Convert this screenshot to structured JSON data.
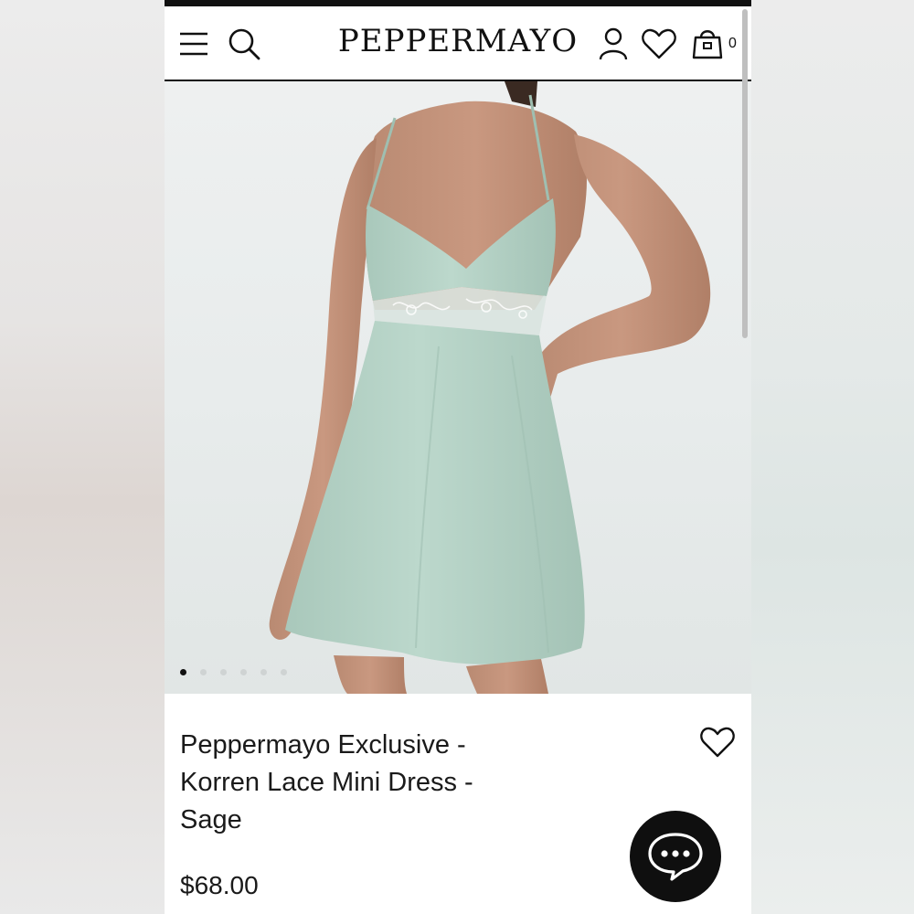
{
  "header": {
    "brand": "PEPPERMAYO",
    "icons": [
      "menu-icon",
      "search-icon",
      "account-icon",
      "wishlist-icon",
      "cart-icon"
    ],
    "cart_count": "0"
  },
  "gallery": {
    "image": "sage satin lace mini dress on model",
    "slide_count": 6,
    "active_slide": 1
  },
  "product": {
    "title_lines": [
      "Peppermayo Exclusive -",
      "Korren Lace Mini Dress -",
      "Sage"
    ],
    "price": "$68.00"
  },
  "colors": {
    "dress": "#b5d2c6",
    "background": "#e8ecec",
    "chat_button": "#0f0f0f"
  }
}
